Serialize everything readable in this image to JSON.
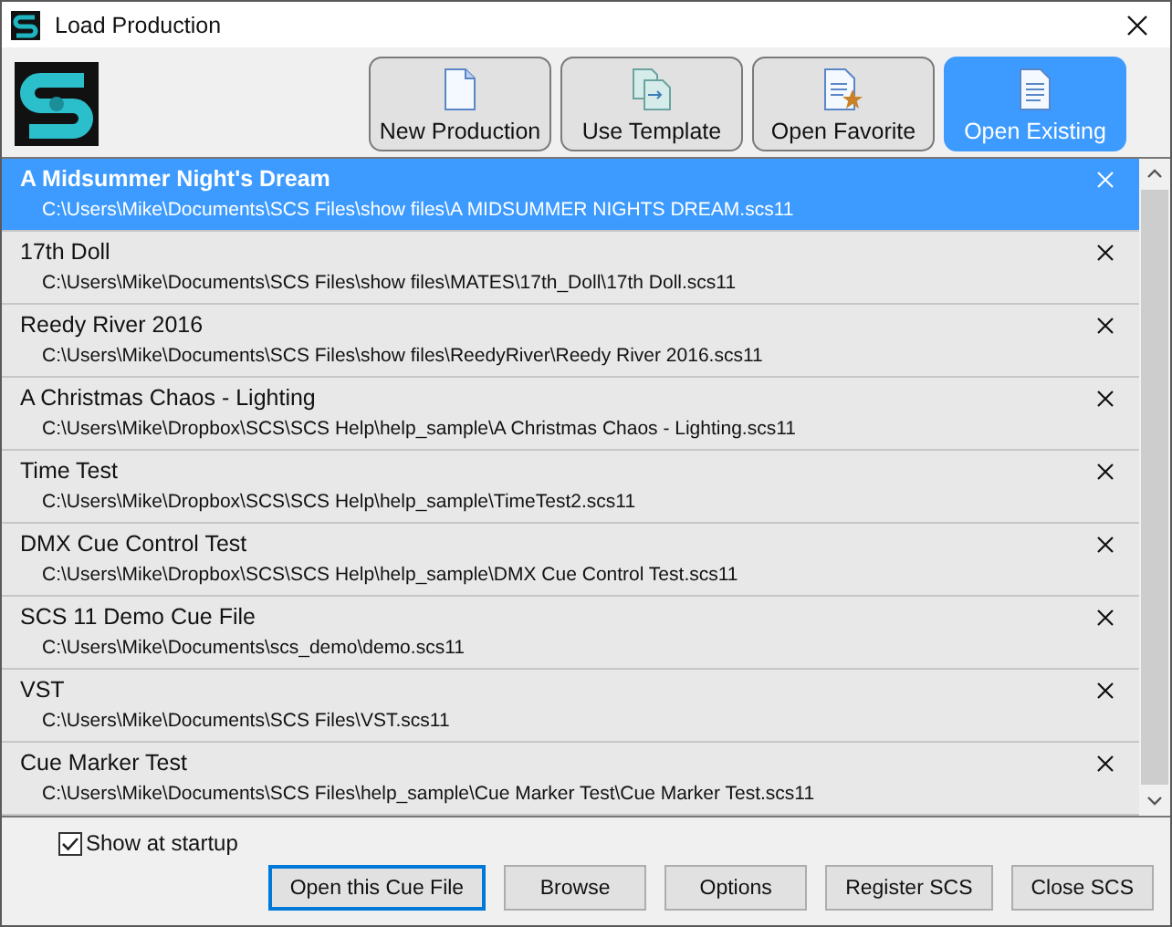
{
  "window": {
    "title": "Load Production"
  },
  "toolbar": [
    {
      "label": "New Production",
      "kind": "new",
      "selected": false
    },
    {
      "label": "Use Template",
      "kind": "template",
      "selected": false
    },
    {
      "label": "Open Favorite",
      "kind": "favorite",
      "selected": false
    },
    {
      "label": "Open Existing",
      "kind": "existing",
      "selected": true
    }
  ],
  "files": [
    {
      "name": "A Midsummer Night's Dream",
      "path": "C:\\Users\\Mike\\Documents\\SCS Files\\show files\\A MIDSUMMER NIGHTS DREAM.scs11",
      "selected": true
    },
    {
      "name": "17th Doll",
      "path": "C:\\Users\\Mike\\Documents\\SCS Files\\show files\\MATES\\17th_Doll\\17th Doll.scs11",
      "selected": false
    },
    {
      "name": "Reedy River 2016",
      "path": "C:\\Users\\Mike\\Documents\\SCS Files\\show files\\ReedyRiver\\Reedy River 2016.scs11",
      "selected": false
    },
    {
      "name": "A Christmas Chaos - Lighting",
      "path": "C:\\Users\\Mike\\Dropbox\\SCS\\SCS Help\\help_sample\\A Christmas Chaos - Lighting.scs11",
      "selected": false
    },
    {
      "name": "Time Test",
      "path": "C:\\Users\\Mike\\Dropbox\\SCS\\SCS Help\\help_sample\\TimeTest2.scs11",
      "selected": false
    },
    {
      "name": "DMX Cue Control Test",
      "path": "C:\\Users\\Mike\\Dropbox\\SCS\\SCS Help\\help_sample\\DMX Cue Control Test.scs11",
      "selected": false
    },
    {
      "name": "SCS 11 Demo Cue File",
      "path": "C:\\Users\\Mike\\Documents\\scs_demo\\demo.scs11",
      "selected": false
    },
    {
      "name": "VST",
      "path": "C:\\Users\\Mike\\Documents\\SCS Files\\VST.scs11",
      "selected": false
    },
    {
      "name": "Cue Marker Test",
      "path": "C:\\Users\\Mike\\Documents\\SCS Files\\help_sample\\Cue Marker Test\\Cue Marker Test.scs11",
      "selected": false
    }
  ],
  "show_at_startup": {
    "label": "Show at startup",
    "checked": true
  },
  "buttons": [
    {
      "label": "Open this Cue File",
      "default": true
    },
    {
      "label": "Browse",
      "default": false
    },
    {
      "label": "Options",
      "default": false
    },
    {
      "label": "Register SCS",
      "default": false
    },
    {
      "label": "Close SCS",
      "default": false
    }
  ]
}
